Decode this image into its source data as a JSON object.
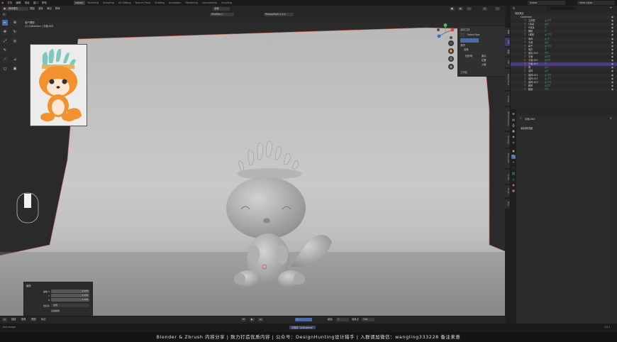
{
  "menu": {
    "items": [
      "文件",
      "编辑",
      "渲染",
      "窗口",
      "帮助"
    ]
  },
  "workspaces": {
    "items": [
      {
        "label": "Layout",
        "active": true
      },
      {
        "label": "Modeling"
      },
      {
        "label": "Sculpting"
      },
      {
        "label": "UV Editing"
      },
      {
        "label": "Texture Paint"
      },
      {
        "label": "Shading"
      },
      {
        "label": "Animation"
      },
      {
        "label": "Rendering"
      },
      {
        "label": "Compositing"
      },
      {
        "label": "Scripting"
      }
    ]
  },
  "topright": {
    "scene_label": "Scene",
    "view_layer": "View Layer"
  },
  "viewport_header": {
    "mode": "物体模式",
    "view": "视图",
    "select": "选择",
    "add": "添加",
    "object": "物体",
    "global": "全局",
    "modifier_label": "Modifier.1",
    "retopo_label": "RetopoFlow 3.3.0"
  },
  "overlay": {
    "line1": "用户透视",
    "line2": "(1) Collection | 平面.003"
  },
  "npanel": {
    "tool_title": "活动工具",
    "select_box": "Select Box",
    "options": "选项",
    "transform": "变换",
    "affect_only": "仅影响",
    "origins": "原点",
    "locations": "位置",
    "parents": "父级",
    "workspace": "工作区"
  },
  "vtabs": [
    "项目",
    "工具",
    "视图",
    "Edit",
    "RetopoFlow",
    "Create",
    "MESHmachine",
    "HardOps",
    "BoxCutter",
    "Sculpt",
    "Brush",
    "Misc"
  ],
  "lastop": {
    "title": "缩放",
    "rows": [
      {
        "label": "缩放 X",
        "value": "1.135"
      },
      {
        "label": "Y",
        "value": "1.135"
      },
      {
        "label": "Z",
        "value": "1.135"
      }
    ],
    "orientation_label": "坐标系",
    "orientation_value": "全局",
    "prop_edit": "衰减编辑"
  },
  "timeline": {
    "items": [
      "回放",
      "抠像",
      "视图",
      "标记"
    ],
    "frame": "1",
    "start": "起始",
    "start_val": "1",
    "end": "结束点",
    "end_val": "250"
  },
  "statusbar": {
    "left": "Anti-Image",
    "center": "已保存 \"p28.blend\"",
    "right": "3.6.2"
  },
  "caption": "Blender  &  Zbrush 内容分享   |   致力打造优质内容   |   公众号：DesignHunting设计猎手   |   入群请加微信：wangling333228 备注来意",
  "outliner": {
    "header": "场景集合",
    "collection": "Collection",
    "rows": [
      {
        "name": "立体型",
        "mods": "◎ ▽▽"
      },
      {
        "name": "L耳朵",
        "mods": "◎▽"
      },
      {
        "name": "R耳朵",
        "mods": "▽"
      },
      {
        "name": "眼睛",
        "mods": "▽"
      },
      {
        "name": "L眼睛",
        "mods": "◎ ▽▽"
      },
      {
        "name": "身体",
        "mods": "◎ ▽"
      },
      {
        "name": "头部",
        "mods": "◎▽"
      },
      {
        "name": "鼻子",
        "mods": "◎ ▽▽"
      },
      {
        "name": "嘴巴",
        "mods": "▽"
      },
      {
        "name": "眉毛.005",
        "mods": "▽▽"
      },
      {
        "name": "平面",
        "mods": "◎▽▽"
      },
      {
        "name": "平面.001",
        "mods": "◎▽▽"
      },
      {
        "name": "平面.003",
        "mods": "▽",
        "selected": true
      },
      {
        "name": "尾",
        "mods": "◎▽"
      },
      {
        "name": "装饰",
        "mods": "◎▽"
      },
      {
        "name": "装饰.001",
        "mods": "◎ ▽▽"
      },
      {
        "name": "装饰.002",
        "mods": "◎ ▽▽"
      },
      {
        "name": "装饰.003",
        "mods": "◎ ▽▽"
      },
      {
        "name": "脚掌",
        "mods": "◎▽▽"
      },
      {
        "name": "腿部",
        "mods": "▽▽"
      }
    ]
  },
  "properties": {
    "object_name": "平面.003",
    "add_modifier": "添加修改器"
  },
  "colors": {
    "accent": "#4b6aa8",
    "selected_row": "#4a3d7a",
    "modifier": "#5fc7b6",
    "object_icon": "#e0a15a"
  }
}
